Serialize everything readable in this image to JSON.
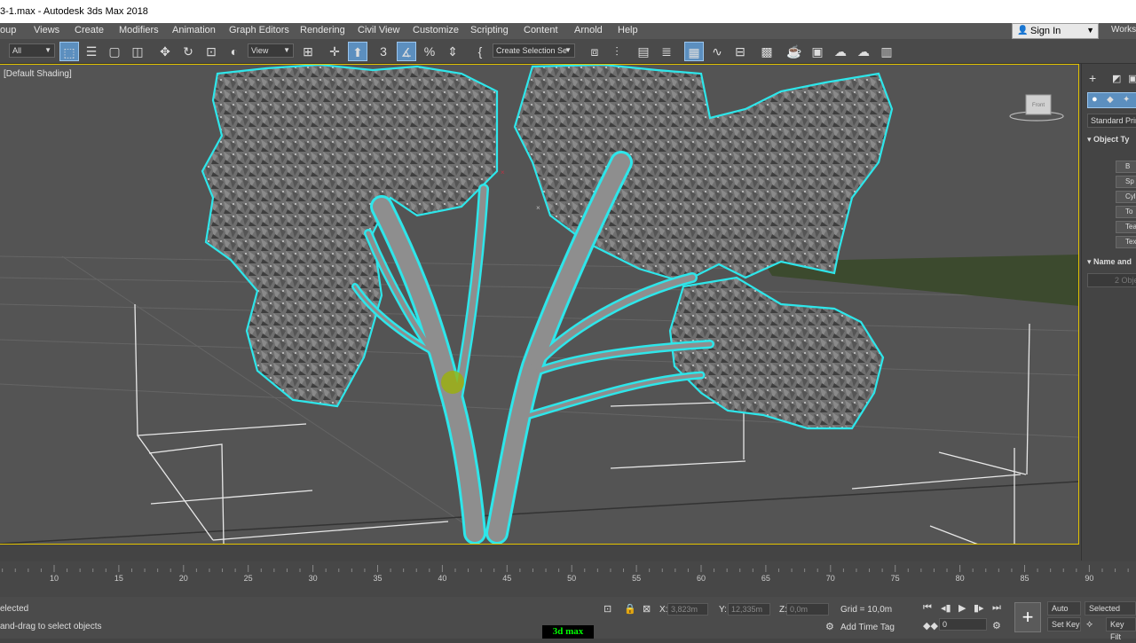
{
  "window": {
    "title": "3-1.max - Autodesk 3ds Max 2018"
  },
  "menu": {
    "items": [
      "oup",
      "Views",
      "Create",
      "Modifiers",
      "Animation",
      "Graph Editors",
      "Rendering",
      "Civil View",
      "Customize",
      "Scripting",
      "Content",
      "Arnold",
      "Help"
    ]
  },
  "account": {
    "sign_in": "Sign In",
    "workspace": "Workspa"
  },
  "toolbar": {
    "filter_value": "All",
    "ref_coord_value": "View",
    "selection_set_value": "Create Selection Se",
    "icons": [
      "select-icon",
      "select-by-name-icon",
      "region-select-icon",
      "window-crossing-icon",
      "move-icon",
      "rotate-icon",
      "scale-icon",
      "placement-icon",
      "pivot-icon",
      "select-manipulate-icon",
      "keyboard-shortcut-icon",
      "snap-3d-icon",
      "angle-snap-icon",
      "percent-snap-icon",
      "spinner-snap-icon",
      "named-selection-icon",
      "mirror-icon",
      "align-icon",
      "layer-explorer-icon",
      "toggle-ribbon-icon",
      "scene-explorer-icon",
      "curve-editor-icon",
      "schematic-view-icon",
      "material-editor-icon",
      "render-setup-icon",
      "rendered-frame-icon",
      "render-production-icon",
      "render-cloud-icon",
      "a360-icon"
    ],
    "active_icons": [
      "select-icon",
      "select-manipulate-icon",
      "angle-snap-icon",
      "toggle-ribbon-icon"
    ]
  },
  "viewport": {
    "label": "[Default Shading]",
    "viewcube_label": "Front",
    "selection_color": "#2ee6ea",
    "background_color": "#545454",
    "active_border_color": "#e3c300"
  },
  "command_panel": {
    "category": "Standard Prim",
    "rollout_object_type": "Object Ty",
    "buttons": [
      "B",
      "Sp",
      "Cyl",
      "To",
      "Tea",
      "Tex"
    ],
    "rollout_name_color": "Name and",
    "name_value": "2 Obje"
  },
  "timeline": {
    "ticks": [
      "10",
      "15",
      "20",
      "25",
      "30",
      "35",
      "40",
      "45",
      "50",
      "55",
      "60",
      "65",
      "70",
      "75",
      "80",
      "85",
      "90"
    ]
  },
  "status": {
    "selection_text": "elected",
    "prompt_text": "and-drag to select objects",
    "x_label": "X:",
    "x_value": "3,823m",
    "y_label": "Y:",
    "y_value": "12,335m",
    "z_label": "Z:",
    "z_value": "0,0m",
    "grid_text": "Grid = 10,0m",
    "add_time_tag": "Add Time Tag",
    "frame_value": "0",
    "auto_key": "Auto Key",
    "auto_key_value": "Selected",
    "set_key": "Set Key",
    "key_filters": "Key Filt"
  },
  "watermark": {
    "text": "3d max"
  }
}
